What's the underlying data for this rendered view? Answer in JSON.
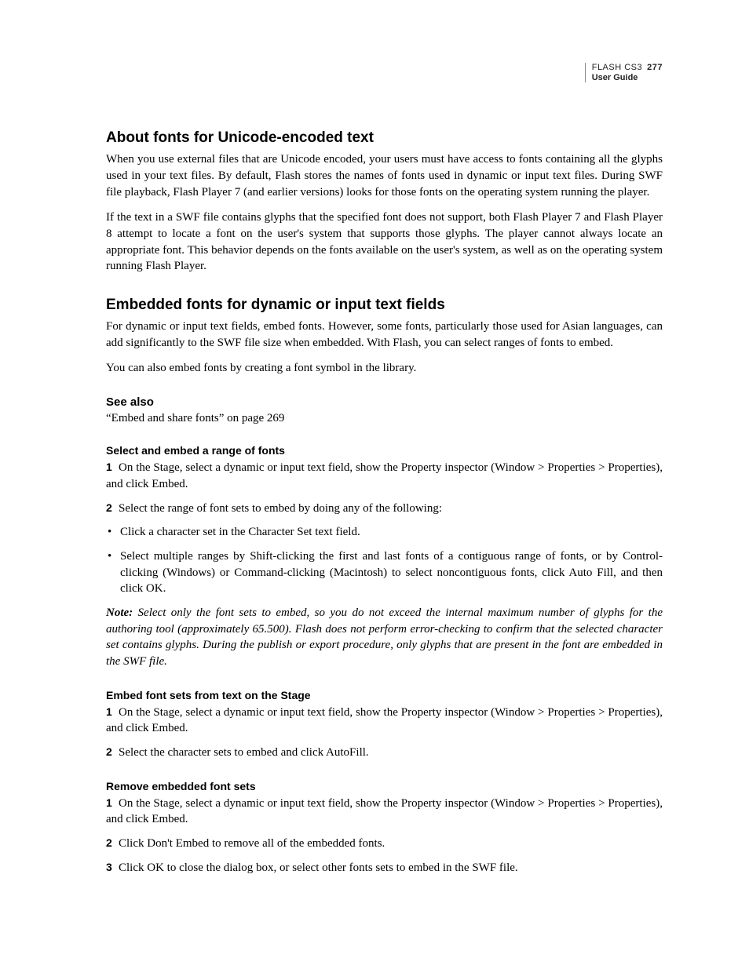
{
  "header": {
    "product": "FLASH CS3",
    "page_number": "277",
    "subtitle": "User Guide"
  },
  "sections": {
    "s1": {
      "title": "About fonts for Unicode-encoded text",
      "p1": "When you use external files that are Unicode encoded, your users must have access to fonts containing all the glyphs used in your text files. By default, Flash stores the names of fonts used in dynamic or input text files. During SWF file playback, Flash Player 7 (and earlier versions) looks for those fonts on the operating system running the player.",
      "p2": "If the text in a SWF file contains glyphs that the specified font does not support, both Flash Player 7 and Flash Player 8 attempt to locate a font on the user's system that supports those glyphs. The player cannot always locate an appropriate font. This behavior depends on the fonts available on the user's system, as well as on the operating system running Flash Player."
    },
    "s2": {
      "title": "Embedded fonts for dynamic or input text fields",
      "p1": "For dynamic or input text fields, embed fonts. However, some fonts, particularly those used for Asian languages, can add significantly to the SWF file size when embedded. With Flash, you can select ranges of fonts to embed.",
      "p2": "You can also embed fonts by creating a font symbol in the library."
    },
    "seealso": {
      "title": "See also",
      "item1": "“Embed and share fonts” on page 269"
    },
    "proc1": {
      "title": "Select and embed a range of fonts",
      "step1": "On the Stage, select a dynamic or input text field, show the Property inspector (Window > Properties > Properties), and click Embed.",
      "step2": "Select the range of font sets to embed by doing any of the following:",
      "bullet1": "Click a character set in the Character Set text field.",
      "bullet2": "Select multiple ranges by Shift-clicking the first and last fonts of a contiguous range of fonts, or by Control-clicking (Windows) or Command-clicking (Macintosh) to select noncontiguous fonts, click Auto Fill, and then click OK.",
      "note_label": "Note:",
      "note_text": " Select only the font sets to embed, so you do not exceed the internal maximum number of glyphs for the authoring tool (approximately 65.500). Flash does not perform error-checking to confirm that the selected character set contains glyphs. During the publish or export procedure, only glyphs that are present in the font are embedded in the SWF file."
    },
    "proc2": {
      "title": "Embed font sets from text on the Stage",
      "step1": "On the Stage, select a dynamic or input text field, show the Property inspector (Window > Properties > Properties), and click Embed.",
      "step2": "Select the character sets to embed and click AutoFill."
    },
    "proc3": {
      "title": "Remove embedded font sets",
      "step1": "On the Stage, select a dynamic or input text field, show the Property inspector (Window > Properties > Properties), and click Embed.",
      "step2": "Click Don't Embed to remove all of the embedded fonts.",
      "step3": "Click OK to close the dialog box, or select other fonts sets to embed in the SWF file."
    },
    "numbers": {
      "n1": "1",
      "n2": "2",
      "n3": "3"
    }
  }
}
